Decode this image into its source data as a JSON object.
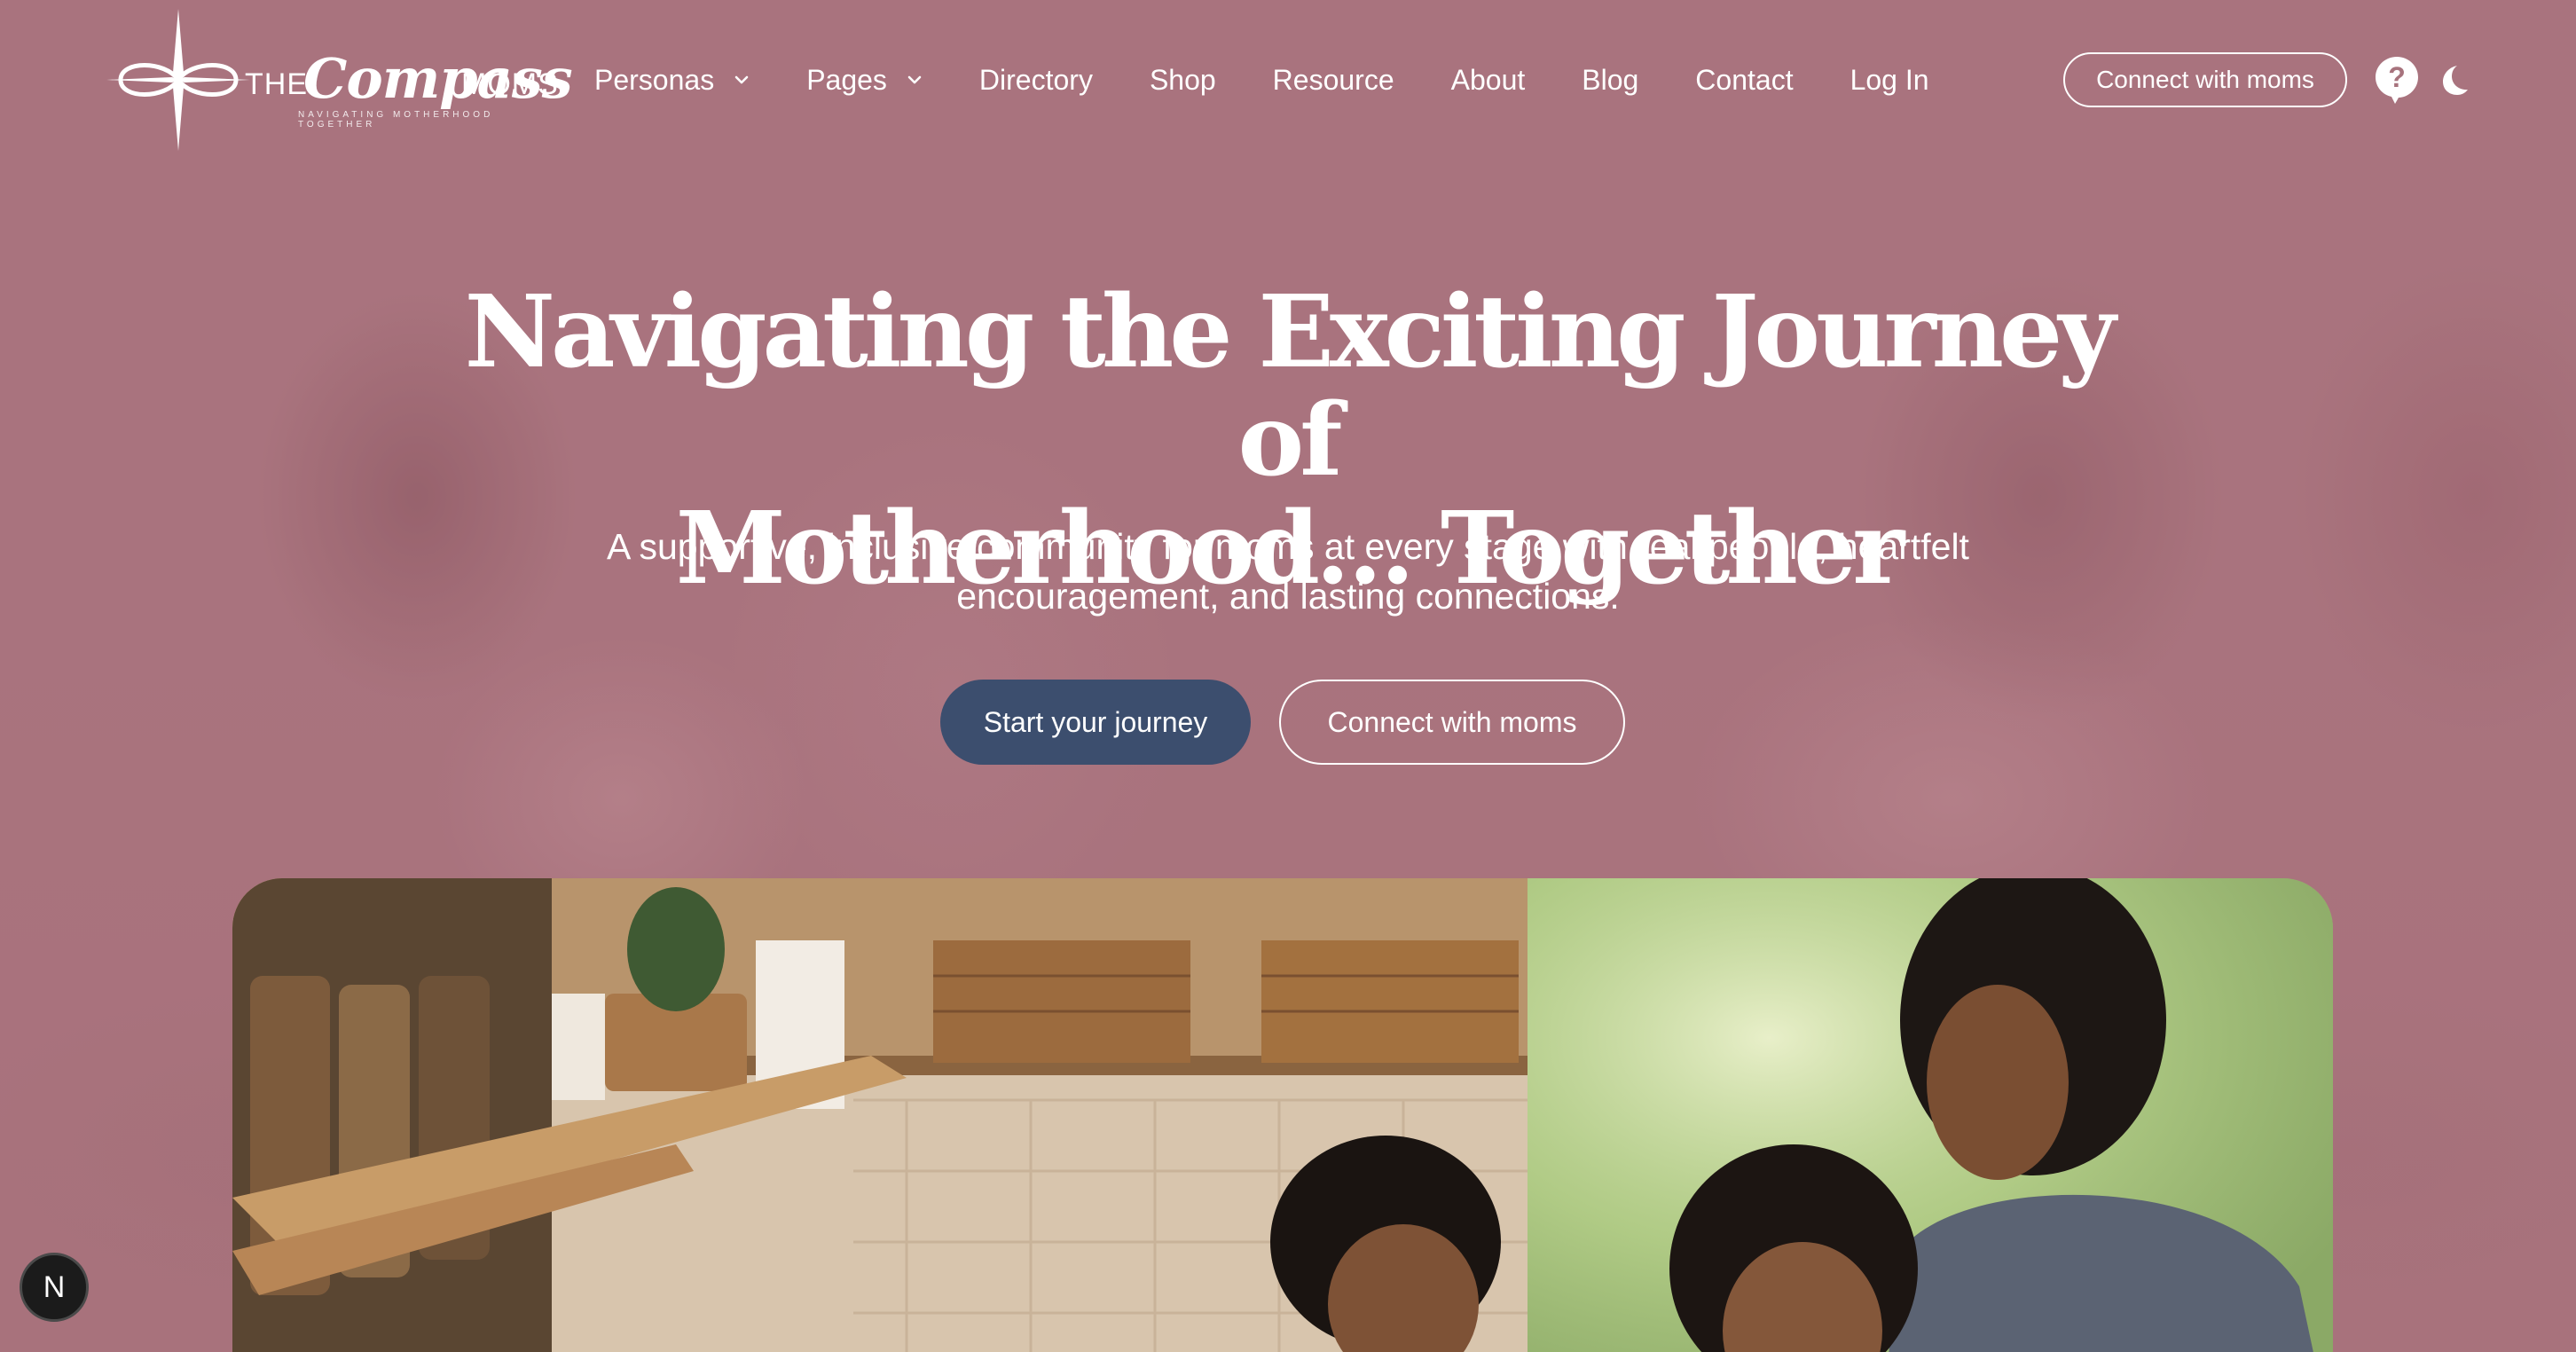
{
  "brand": {
    "the": "THE",
    "name": "Compass",
    "moms": "MOMS",
    "tagline": "NAVIGATING MOTHERHOOD TOGETHER"
  },
  "nav": {
    "items": [
      {
        "label": "Personas",
        "dropdown": true
      },
      {
        "label": "Pages",
        "dropdown": true
      },
      {
        "label": "Directory",
        "dropdown": false
      },
      {
        "label": "Shop",
        "dropdown": false
      },
      {
        "label": "Resource",
        "dropdown": false
      },
      {
        "label": "About",
        "dropdown": false
      },
      {
        "label": "Blog",
        "dropdown": false
      },
      {
        "label": "Contact",
        "dropdown": false
      },
      {
        "label": "Log In",
        "dropdown": false
      }
    ],
    "cta_label": "Connect with moms",
    "help_icon": "help-icon",
    "theme_icon": "moon-icon"
  },
  "hero": {
    "title_line1": "Navigating the Exciting Journey of",
    "title_line2": "Motherhood… Together",
    "subtitle_line1": "A supportive, inclusive community for moms at every stage with real people, heartfelt",
    "subtitle_line2": "encouragement, and lasting connections.",
    "primary_button": "Start your journey",
    "secondary_button": "Connect with moms"
  },
  "dev_badge": "N",
  "colors": {
    "background": "#a7737d",
    "primary_button": "#3c4e6e",
    "text": "#ffffff"
  }
}
